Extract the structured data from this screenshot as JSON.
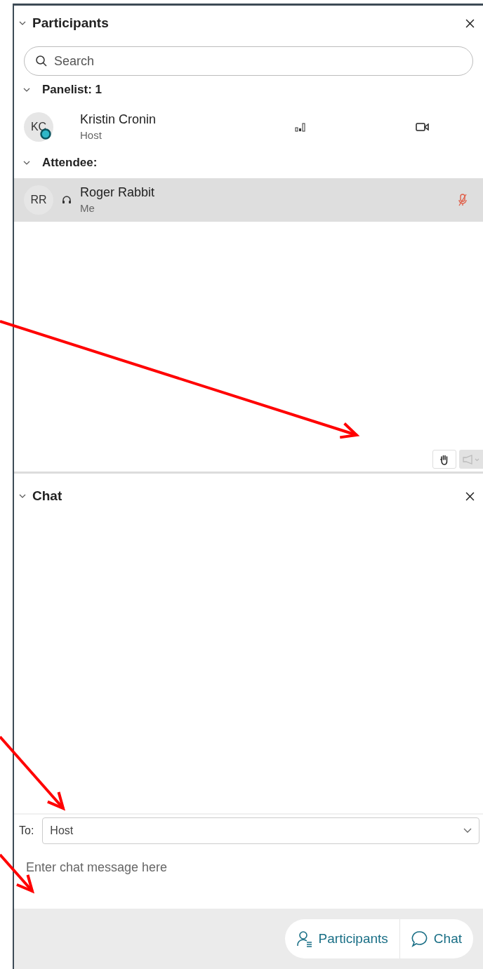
{
  "participants": {
    "title": "Participants",
    "expanded": true,
    "search": {
      "placeholder": "Search"
    },
    "groups": [
      {
        "label": "Panelist: 1",
        "kind": "panelist",
        "expanded": true,
        "members": [
          {
            "initials": "KC",
            "name": "Kristin Cronin",
            "role": "Host",
            "selected": false
          }
        ]
      },
      {
        "label": "Attendee:",
        "kind": "attendee",
        "expanded": true,
        "members": [
          {
            "initials": "RR",
            "name": "Roger Rabbit",
            "role": "Me",
            "selected": true
          }
        ]
      }
    ]
  },
  "chat": {
    "title": "Chat",
    "expanded": true,
    "to_label": "To:",
    "to_value": "Host",
    "placeholder": "Enter chat message here"
  },
  "footer": {
    "buttons": [
      {
        "label": "Participants",
        "kind": "participants"
      },
      {
        "label": "Chat",
        "kind": "chat"
      }
    ]
  }
}
